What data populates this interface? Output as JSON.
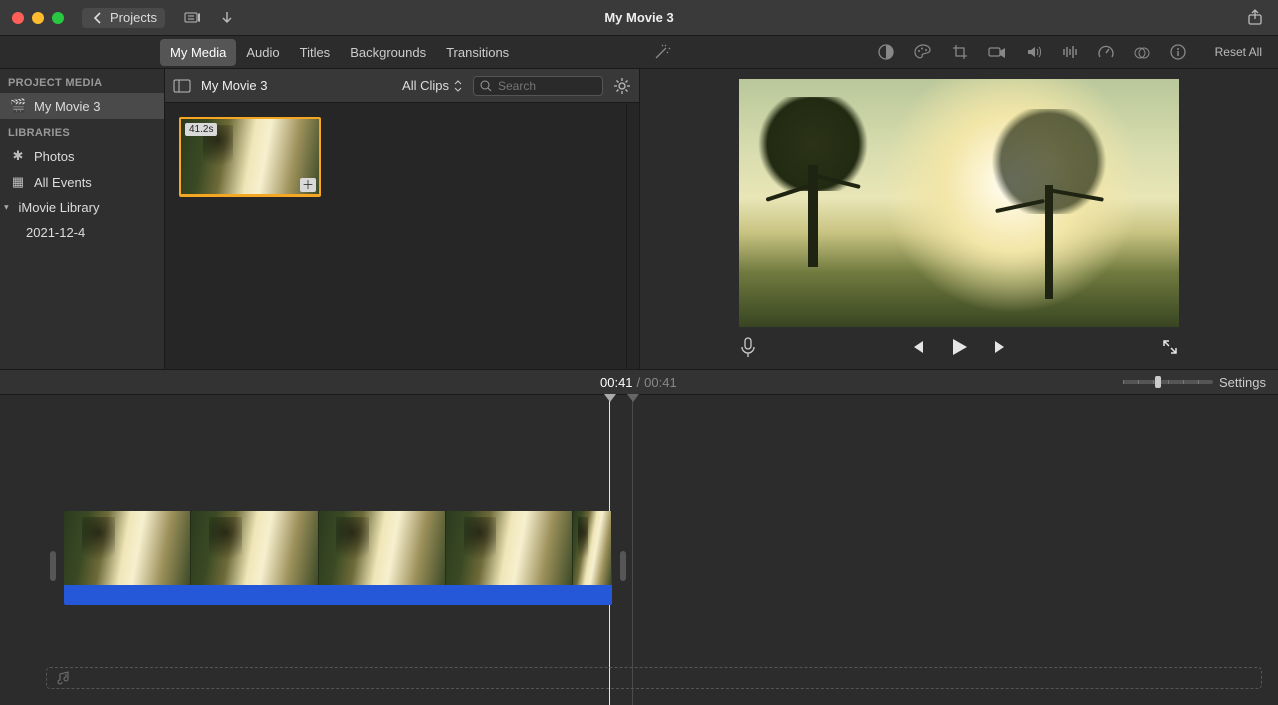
{
  "titlebar": {
    "back_label": "Projects",
    "title": "My Movie 3"
  },
  "tabs": [
    "My Media",
    "Audio",
    "Titles",
    "Backgrounds",
    "Transitions"
  ],
  "active_tab_index": 0,
  "adjust": {
    "reset_label": "Reset All"
  },
  "sidebar": {
    "section1": "PROJECT MEDIA",
    "project_item": "My Movie 3",
    "section2": "LIBRARIES",
    "lib_photos": "Photos",
    "lib_allevents": "All Events",
    "lib_root": "iMovie Library",
    "lib_event": "2021-12-4"
  },
  "browser": {
    "title": "My Movie 3",
    "filter": "All Clips",
    "search_placeholder": "Search",
    "clip_duration": "41.2s"
  },
  "playback": {
    "current": "00:41",
    "total": "00:41",
    "settings_label": "Settings"
  }
}
